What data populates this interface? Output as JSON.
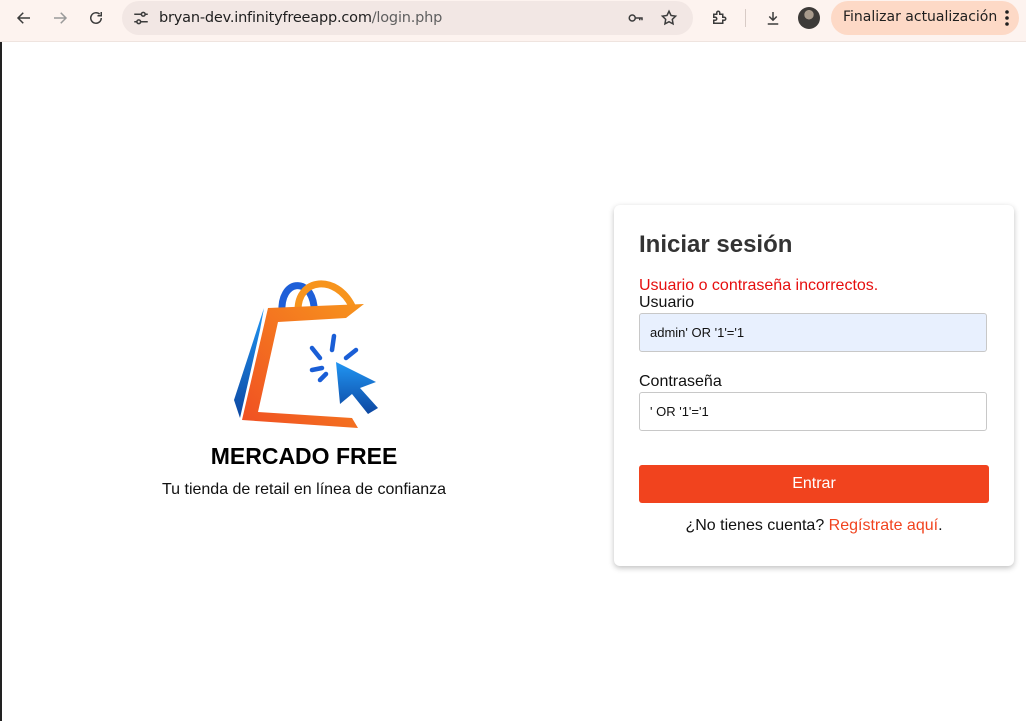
{
  "browser": {
    "url_host": "bryan-dev.infinityfreeapp.com",
    "url_path": "/login.php",
    "update_label": "Finalizar actualización",
    "icons": {
      "back": "arrow-left-icon",
      "forward": "arrow-right-icon",
      "reload": "reload-icon",
      "site_info": "tune-icon",
      "password": "key-icon",
      "bookmark": "star-icon",
      "extensions": "puzzle-icon",
      "downloads": "download-icon",
      "menu": "more-vertical-icon"
    }
  },
  "brand": {
    "name": "MERCADO FREE",
    "tagline": "Tu tienda de retail en línea de confianza",
    "colors": {
      "orange": "#f15a22",
      "blue": "#1565e0"
    }
  },
  "login": {
    "title": "Iniciar sesión",
    "error": "Usuario o contraseña incorrectos.",
    "username_label": "Usuario",
    "username_value": "admin' OR '1'='1",
    "password_label": "Contraseña",
    "password_value": "' OR '1'='1",
    "submit_label": "Entrar",
    "signup_prompt": "¿No tienes cuenta?",
    "signup_link": "Regístrate aquí",
    "signup_suffix": ".",
    "accent_color": "#f1431e",
    "error_color": "#e60f0f"
  }
}
